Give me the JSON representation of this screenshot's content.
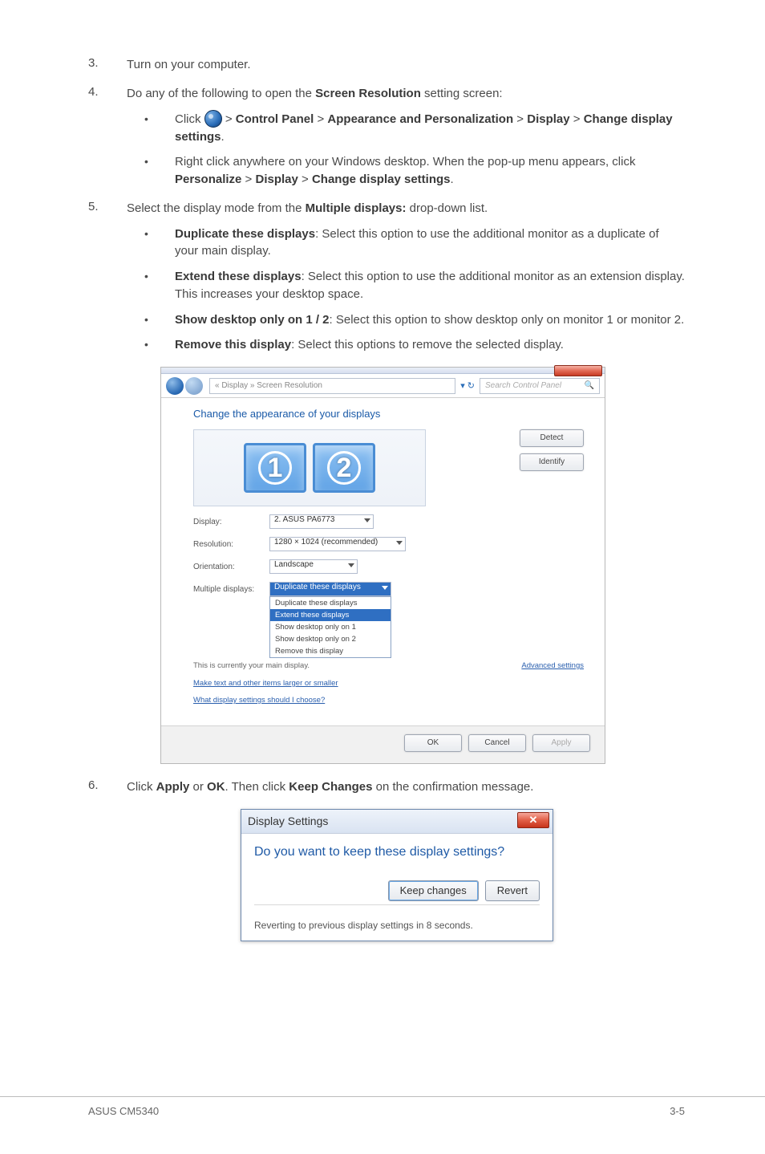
{
  "steps": {
    "s3": {
      "num": "3.",
      "text": "Turn on your computer."
    },
    "s4": {
      "num": "4.",
      "lead_a": "Do any of the following to open the ",
      "lead_bold": "Screen Resolution",
      "lead_b": " setting screen:",
      "b1": {
        "pre": "Click ",
        "path_a": "Control Panel",
        "path_b": "Appearance and Personalization",
        "path_c": "Display",
        "path_d": "Change display settings"
      },
      "b2": {
        "a": "Right click anywhere on your Windows desktop. When the pop-up menu appears, click ",
        "p1": "Personalize",
        "p2": "Display",
        "p3": "Change display settings"
      }
    },
    "s5": {
      "num": "5.",
      "lead_a": "Select the display mode from the ",
      "lead_bold": "Multiple displays:",
      "lead_b": " drop-down list.",
      "opt1": {
        "t": "Duplicate these displays",
        "d": ": Select this option to use the additional monitor as a duplicate of your main display."
      },
      "opt2": {
        "t": "Extend these displays",
        "d": ": Select this option to use the additional monitor as an extension display. This increases your desktop space."
      },
      "opt3": {
        "t": "Show desktop only on 1 / 2",
        "d": ": Select this option to show desktop only on monitor 1 or monitor 2."
      },
      "opt4": {
        "t": "Remove this display",
        "d": ": Select this options to remove the selected display."
      }
    },
    "s6": {
      "num": "6.",
      "a": "Click ",
      "b1": "Apply",
      "mid": " or ",
      "b2": "OK",
      "c": ". Then click ",
      "b3": "Keep Changes",
      "d": " on the confirmation message."
    }
  },
  "dlg1": {
    "breadcrumb": "« Display » Screen Resolution",
    "search_ph": "Search Control Panel",
    "heading": "Change the appearance of your displays",
    "mon1": "1",
    "mon2": "2",
    "btn_detect": "Detect",
    "btn_identify": "Identify",
    "rows": {
      "display": {
        "label": "Display:",
        "value": "2. ASUS PA6773"
      },
      "resolution": {
        "label": "Resolution:",
        "value": "1280 × 1024 (recommended)"
      },
      "orientation": {
        "label": "Orientation:",
        "value": "Landscape"
      },
      "multiple": {
        "label": "Multiple displays:",
        "value": "Duplicate these displays"
      }
    },
    "dd": {
      "o1": "Duplicate these displays",
      "o2": "Extend these displays",
      "o3": "Show desktop only on 1",
      "o4": "Show desktop only on 2",
      "o5": "Remove this display"
    },
    "link_main": "This is currently your main display.",
    "link_adv": "Advanced settings",
    "link_text": "Make text and other items larger or smaller",
    "link_proj": "What display settings should I choose?",
    "btn_ok": "OK",
    "btn_cancel": "Cancel",
    "btn_apply": "Apply"
  },
  "dlg2": {
    "title": "Display Settings",
    "question": "Do you want to keep these display settings?",
    "btn_keep": "Keep changes",
    "btn_revert": "Revert",
    "footer": "Reverting to previous display settings in 8 seconds."
  },
  "footer": {
    "left": "ASUS CM5340",
    "right": "3-5"
  }
}
